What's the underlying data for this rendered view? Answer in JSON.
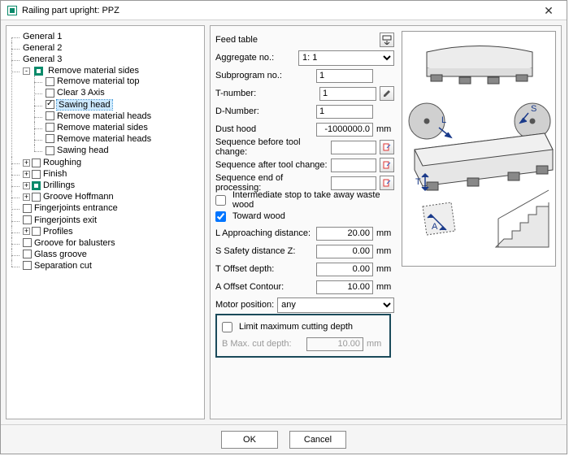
{
  "title": "Railing part upright: PPZ",
  "tree": {
    "general1": "General 1",
    "general2": "General 2",
    "general3": "General 3",
    "remove_sides": "Remove material sides",
    "remove_top": "Remove material top",
    "clear3axis": "Clear 3 Axis",
    "sawing_head": "Sawing head",
    "remove_heads1": "Remove material heads",
    "remove_sides2": "Remove material sides",
    "remove_heads2": "Remove material heads",
    "sawing_head2": "Sawing head",
    "roughing": "Roughing",
    "finish": "Finish",
    "drillings": "Drillings",
    "groove_hoffmann": "Groove Hoffmann",
    "finger_entrance": "Fingerjoints entrance",
    "finger_exit": "Fingerjoints exit",
    "profiles": "Profiles",
    "groove_balusters": "Groove for balusters",
    "glass_groove": "Glass groove",
    "separation_cut": "Separation cut"
  },
  "form": {
    "feed_table": "Feed table",
    "aggregate_label": "Aggregate no.:",
    "aggregate_value": "1: 1",
    "subprogram_label": "Subprogram no.:",
    "subprogram_value": "1",
    "tnumber_label": "T-number:",
    "tnumber_value": "1",
    "dnumber_label": "D-Number:",
    "dnumber_value": "1",
    "dusthood_label": "Dust hood",
    "dusthood_value": "-1000000.0",
    "seq_before_label": "Sequence before tool change:",
    "seq_after_label": "Sequence after tool change:",
    "seq_end_label": "Sequence end of processing:",
    "intermediate_stop": "Intermediate stop to take away waste wood",
    "toward_wood": "Toward wood",
    "l_approach_label": "L Approaching distance:",
    "l_approach_value": "20.00",
    "s_safety_label": "S Safety distance Z:",
    "s_safety_value": "0.00",
    "t_offset_label": "T Offset depth:",
    "t_offset_value": "0.00",
    "a_offset_label": "A Offset Contour:",
    "a_offset_value": "10.00",
    "motor_label": "Motor position:",
    "motor_value": "any",
    "limit_label": "Limit maximum cutting depth",
    "bmax_label": "B Max. cut depth:",
    "bmax_value": "10.00",
    "unit_mm": "mm"
  },
  "footer": {
    "ok": "OK",
    "cancel": "Cancel"
  },
  "diagram_labels": {
    "L": "L",
    "S": "S",
    "T": "T",
    "A": "A"
  }
}
